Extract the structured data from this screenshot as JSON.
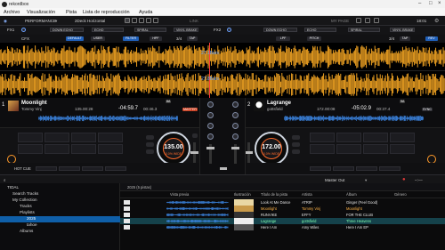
{
  "window": {
    "title": "rekordbox"
  },
  "menu": [
    "Archivo",
    "Visualización",
    "Pista",
    "Lista de reproducción",
    "Ayuda"
  ],
  "toolbar": {
    "mode": "PERFORMANCE",
    "layout": "2Deck Horizontal",
    "link": "LINK",
    "my_page": "MY PAGE",
    "clock": "18:01"
  },
  "fx": {
    "fx1": "FX1",
    "fx2": "FX2",
    "effects": [
      "DOWN ECHO",
      "ECHO",
      "SPIRAL",
      "VINYL BRAKE"
    ],
    "effects2": [
      "DOWN ECHO",
      "ECHO",
      "SPIRAL",
      "VINYL BRAKE"
    ],
    "beat": "3/4",
    "tap": "TAP",
    "cfx": "CFX",
    "default": "DEFAULT",
    "user": "USER",
    "filter": "FILTER",
    "hpf": "HPF",
    "lpf": "LPF",
    "pitch": "PITCH",
    "rev": "REV"
  },
  "waveform": {
    "bpm_a": "27.1Bars",
    "bpm_b": "27.8Bars"
  },
  "deck1": {
    "number": "1",
    "title": "Moonlight",
    "artist": "Tommy Vinj",
    "elapsed": "135.00:28",
    "remain": "-04:59.7",
    "total": "00:46.3",
    "key": "8A",
    "master": "MASTER",
    "bpm": "135.00",
    "bpm_pct": "0.0% WIDE",
    "hot_cue": "HOT CUE"
  },
  "deck2": {
    "number": "2",
    "title": "Lagrange",
    "artist": "gottsfield",
    "elapsed": "172.00:08",
    "remain": "-05:02.9",
    "total": "00:37.4",
    "key": "9A",
    "sync": "SYNC",
    "bpm": "172.00",
    "bpm_pct": "0.0% WIDE"
  },
  "browser": {
    "master_out": "Master Out",
    "playlist_header": "2025 (5 pistas)",
    "columns": [
      "Vista previa",
      "Ilustración",
      "Título de la pista",
      "Artista",
      "Álbum",
      "Género"
    ],
    "tree": [
      {
        "label": "TIDAL"
      },
      {
        "label": "Search Tracks"
      },
      {
        "label": "My Collection"
      },
      {
        "label": "Tracks"
      },
      {
        "label": "Playlists"
      },
      {
        "label": "2025"
      },
      {
        "label": "tahoe"
      },
      {
        "label": "Albums"
      }
    ],
    "rows": [
      {
        "title": "Look At Me Dance",
        "artist": "ATRIP",
        "album": "Ginger (Feel Good)"
      },
      {
        "title": "Moonlight",
        "artist": "Tommy Vinj",
        "album": "Moonlight"
      },
      {
        "title": "RUNVIKE",
        "artist": "EFFY",
        "album": "FOR THE CLUB"
      },
      {
        "title": "Lagrange",
        "artist": "gottsfield",
        "album": "Three Heavens"
      },
      {
        "title": "Here I Am",
        "artist": "Amy Wiles",
        "album": "Here I Am EP"
      }
    ]
  },
  "colors": {
    "accent": "#0f5fa8",
    "wave_orange": "#f5a623",
    "wave_blue": "#3f8ef2",
    "play": "#50ff50",
    "cue": "#ff9a2a"
  }
}
